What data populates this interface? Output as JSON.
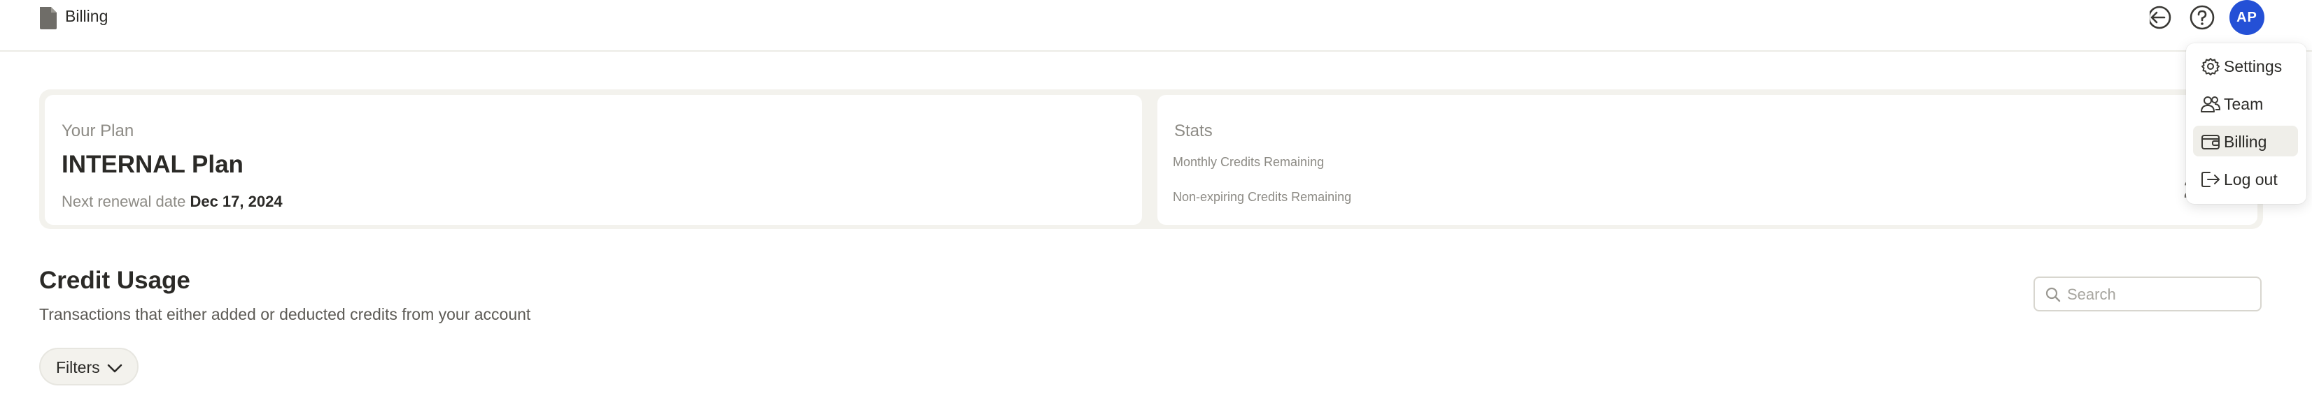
{
  "header": {
    "title": "Billing",
    "avatar_initials": "AP",
    "avatar_color": "#2450d6"
  },
  "plan": {
    "label": "Your Plan",
    "name": "INTERNAL Plan",
    "renewal_label": "Next renewal date",
    "renewal_date": "Dec 17, 2024"
  },
  "stats": {
    "label": "Stats",
    "monthly_label": "Monthly Credits Remaining",
    "nonexpiring_label": "Non-expiring Credits Remaining",
    "nonexpiring_value": "29105"
  },
  "credit_usage": {
    "title": "Credit Usage",
    "subtitle": "Transactions that either added or deducted credits from your account",
    "search_placeholder": "Search",
    "filters_label": "Filters"
  },
  "menu": {
    "items": [
      {
        "label": "Settings",
        "icon": "gear-icon"
      },
      {
        "label": "Team",
        "icon": "users-icon"
      },
      {
        "label": "Billing",
        "icon": "wallet-icon",
        "active": true
      },
      {
        "label": "Log out",
        "icon": "logout-icon"
      }
    ]
  }
}
